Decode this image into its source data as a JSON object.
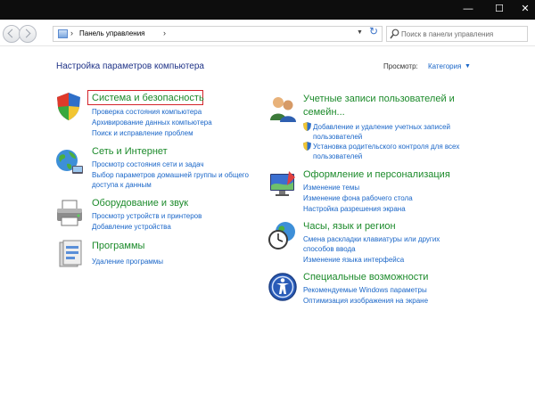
{
  "window": {
    "minimize": "—",
    "maximize": "☐",
    "close": "✕"
  },
  "address": {
    "crumb": "Панель управления",
    "crumb_sep": "›",
    "end_sep": "›",
    "dropdown_arrow": "▼",
    "refresh": "↻",
    "search_placeholder": "Поиск в панели управления"
  },
  "main": {
    "heading": "Настройка параметров компьютера",
    "view_by_label": "Просмотр:",
    "view_by_value": "Категория",
    "view_by_arrow": "▼"
  },
  "left_categories": [
    {
      "title": "Система и безопасность",
      "icon": "shield-icon",
      "links": [
        "Проверка состояния компьютера",
        "Архивирование данных компьютера",
        "Поиск и исправление проблем"
      ]
    },
    {
      "title": "Сеть и Интернет",
      "icon": "network-globe-icon",
      "links": [
        "Просмотр состояния сети и задач",
        "Выбор параметров домашней группы и общего",
        "доступа к данным"
      ]
    },
    {
      "title": "Оборудование и звук",
      "icon": "printer-icon",
      "links": [
        "Просмотр устройств и принтеров",
        "Добавление устройства"
      ]
    },
    {
      "title": "Программы",
      "icon": "programs-icon",
      "links": [
        "Удаление программы"
      ]
    }
  ],
  "right_categories": [
    {
      "title_line1": "Учетные записи пользователей и",
      "title_line2": "семейн...",
      "icon": "users-icon",
      "links": [
        "Добавление и удаление учетных записей",
        "пользователей",
        "Установка родительского контроля для всех",
        "пользователей"
      ]
    },
    {
      "title": "Оформление и персонализация",
      "icon": "personalization-icon",
      "links": [
        "Изменение темы",
        "Изменение фона рабочего стола",
        "Настройка разрешения экрана"
      ]
    },
    {
      "title": "Часы, язык и регион",
      "icon": "clock-globe-icon",
      "links": [
        "Смена раскладки клавиатуры или других",
        "способов ввода",
        "Изменение языка интерфейса"
      ]
    },
    {
      "title": "Специальные возможности",
      "icon": "accessibility-icon",
      "links": [
        "Рекомендуемые Windows параметры",
        "Оптимизация изображения на экране"
      ]
    }
  ]
}
